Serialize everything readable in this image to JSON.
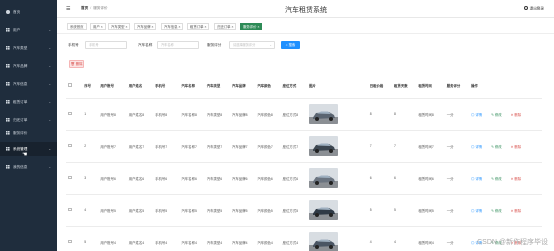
{
  "sidebar": {
    "items": [
      {
        "label": "首页",
        "icon": "dot-icon"
      },
      {
        "label": "用户",
        "icon": "grid-icon"
      },
      {
        "label": "汽车类型",
        "icon": "grid-icon"
      },
      {
        "label": "汽车品牌",
        "icon": "grid-icon"
      },
      {
        "label": "汽车信息",
        "icon": "grid-icon"
      },
      {
        "label": "租赁订单",
        "icon": "grid-icon"
      },
      {
        "label": "归还订单",
        "icon": "grid-icon"
      },
      {
        "label": "服务评价",
        "icon": "grid-icon"
      },
      {
        "label": "系统管理",
        "icon": "grid-icon"
      },
      {
        "label": "我的信息",
        "icon": "grid-icon"
      }
    ]
  },
  "header": {
    "breadcrumb_home": "首页",
    "breadcrumb_current": "服务评价",
    "title": "汽车租赁系统",
    "logout": "退出登录"
  },
  "tabs": [
    "系统首页",
    "用户 ×",
    "汽车类型 ×",
    "汽车品牌 ×",
    "汽车信息 ×",
    "租赁订单 ×",
    "归还订单 ×",
    "服务评价 ×"
  ],
  "search": {
    "label1": "手机号",
    "placeholder1": "手机号",
    "label2": "汽车名称",
    "placeholder2": "汽车名称",
    "label3": "服务评分",
    "placeholder3": "请选择服务评分",
    "button": "搜索"
  },
  "delete_button": "删除",
  "table": {
    "headers": [
      "",
      "序号",
      "用户账号",
      "用户姓名",
      "手机号",
      "汽车名称",
      "汽车类型",
      "汽车品牌",
      "汽车颜色",
      "座位方式",
      "图片",
      "日租价格",
      "租赁天数",
      "租赁时间",
      "服务评分",
      "操作"
    ],
    "rows": [
      {
        "no": "1",
        "account": "用户账号8",
        "name": "用户姓名8",
        "phone": "手机号8",
        "car": "汽车名称8",
        "type": "汽车类型8",
        "brand": "汽车品牌8",
        "color": "汽车颜色8",
        "seat": "座位方式8",
        "price": "8",
        "days": "8",
        "time": "租赁时间8",
        "score": "一分"
      },
      {
        "no": "2",
        "account": "用户账号7",
        "name": "用户姓名7",
        "phone": "手机号7",
        "car": "汽车名称7",
        "type": "汽车类型7",
        "brand": "汽车品牌7",
        "color": "汽车颜色7",
        "seat": "座位方式7",
        "price": "7",
        "days": "7",
        "time": "租赁时间7",
        "score": "一分"
      },
      {
        "no": "3",
        "account": "用户账号6",
        "name": "用户姓名6",
        "phone": "手机号6",
        "car": "汽车名称6",
        "type": "汽车类型6",
        "brand": "汽车品牌6",
        "color": "汽车颜色6",
        "seat": "座位方式6",
        "price": "6",
        "days": "6",
        "time": "租赁时间6",
        "score": "一分"
      },
      {
        "no": "4",
        "account": "用户账号5",
        "name": "用户姓名5",
        "phone": "手机号5",
        "car": "汽车名称5",
        "type": "汽车类型5",
        "brand": "汽车品牌5",
        "color": "汽车颜色5",
        "seat": "座位方式5",
        "price": "5",
        "days": "5",
        "time": "租赁时间5",
        "score": "一分"
      },
      {
        "no": "5",
        "account": "用户账号4",
        "name": "用户姓名4",
        "phone": "手机号4",
        "car": "汽车名称4",
        "type": "汽车类型4",
        "brand": "汽车品牌4",
        "color": "汽车颜色4",
        "seat": "座位方式4",
        "price": "4",
        "days": "4",
        "time": "租赁时间4",
        "score": "一分"
      }
    ],
    "actions": {
      "detail": "详情",
      "edit": "修改",
      "delete": "删除"
    }
  },
  "watermark": "CSDN @新作程序毕设",
  "colors": {
    "sidebar": "#1f2d3d",
    "accent": "#2e8b57",
    "primary": "#1e90ff",
    "danger": "#d9534f"
  }
}
